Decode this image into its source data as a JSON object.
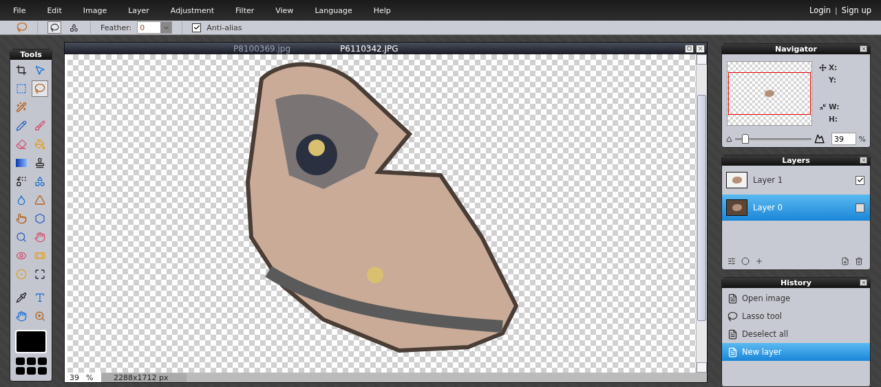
{
  "menu_bar": {
    "items": [
      "File",
      "Edit",
      "Image",
      "Layer",
      "Adjustment",
      "Filter",
      "View",
      "Language",
      "Help"
    ],
    "account": [
      "Login",
      "|",
      "Sign up"
    ]
  },
  "options_bar": {
    "modes": [
      {
        "selected": true
      },
      {
        "selected": false
      }
    ],
    "feather": {
      "label": "Feather:",
      "value": "0"
    },
    "anti_alias": {
      "label": "Anti-alias",
      "checked": true
    }
  },
  "tools": {
    "title": "Tools",
    "rows": [
      [
        {
          "selected": false
        },
        {
          "selected": false
        }
      ],
      [
        {
          "selected": false
        },
        {
          "selected": true
        }
      ],
      [
        {
          "selected": false
        }
      ],
      [
        {
          "selected": false
        },
        {
          "selected": false
        }
      ],
      [
        {
          "selected": false
        },
        {
          "selected": false
        }
      ],
      [
        {
          "selected": false
        },
        {
          "selected": false
        }
      ],
      [
        {
          "selected": false
        },
        {
          "selected": false
        }
      ],
      [
        {
          "selected": false
        },
        {
          "selected": false
        }
      ],
      [
        {
          "selected": false
        },
        {
          "selected": false
        }
      ],
      [
        {
          "selected": false
        },
        {
          "selected": false
        }
      ],
      [
        {
          "selected": false
        },
        {
          "selected": false
        }
      ],
      [
        {
          "selected": false
        },
        {
          "selected": false
        }
      ],
      [
        {
          "selected": false
        },
        {
          "selected": false
        }
      ],
      [
        {
          "selected": false
        },
        {
          "selected": false
        }
      ]
    ]
  },
  "document": {
    "background_title": "P8100369.jpg",
    "title": "P6110342.JPG",
    "status": {
      "zoom": "39",
      "unit": "%",
      "size": "2288x1712 px"
    }
  },
  "navigator": {
    "title": "Navigator",
    "labels": [
      "X:",
      "Y:",
      "W:",
      "H:"
    ],
    "zoom": {
      "level": 0.1,
      "value": "39",
      "unit": "%"
    }
  },
  "layers": {
    "title": "Layers",
    "items": [
      {
        "name": "Layer 1",
        "selected": false,
        "visible": true
      },
      {
        "name": "Layer 0",
        "selected": true,
        "visible": false
      }
    ]
  },
  "history": {
    "title": "History",
    "items": [
      {
        "label": "Open image",
        "kind": "command",
        "selected": false
      },
      {
        "label": "Lasso tool",
        "kind": "tool",
        "selected": false
      },
      {
        "label": "Deselect all",
        "kind": "command",
        "selected": false
      },
      {
        "label": "New layer",
        "kind": "command",
        "selected": true
      }
    ]
  }
}
